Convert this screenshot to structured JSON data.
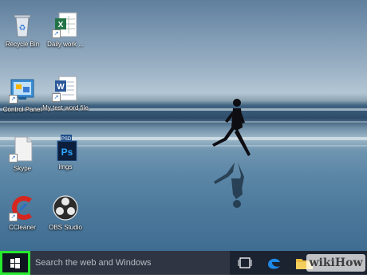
{
  "desktop": {
    "icons": [
      {
        "label": "Recycle Bin",
        "icon": "recycle-bin-icon"
      },
      {
        "label": "Daily work ...",
        "icon": "excel-file-icon"
      },
      {
        "label": "Control Panel",
        "icon": "control-panel-icon"
      },
      {
        "label": "My test word file",
        "icon": "word-file-icon"
      },
      {
        "label": "Skype",
        "icon": "blank-shortcut-icon"
      },
      {
        "label": "imgs",
        "icon": "photoshop-file-icon"
      },
      {
        "label": "CCleaner",
        "icon": "ccleaner-icon"
      },
      {
        "label": "OBS Studio",
        "icon": "obs-studio-icon"
      }
    ],
    "psd_tag": "PSD",
    "ps_text": "Ps",
    "excel_letter": "X",
    "word_letter": "W"
  },
  "taskbar": {
    "start_icon": "windows-logo-icon",
    "search_placeholder": "Search the web and Windows",
    "task_view_icon": "task-view-icon",
    "edge_icon": "edge-browser-icon",
    "explorer_icon": "file-explorer-icon",
    "highlight_color": "#26e82e"
  },
  "watermark": {
    "text": "wikiHow"
  }
}
